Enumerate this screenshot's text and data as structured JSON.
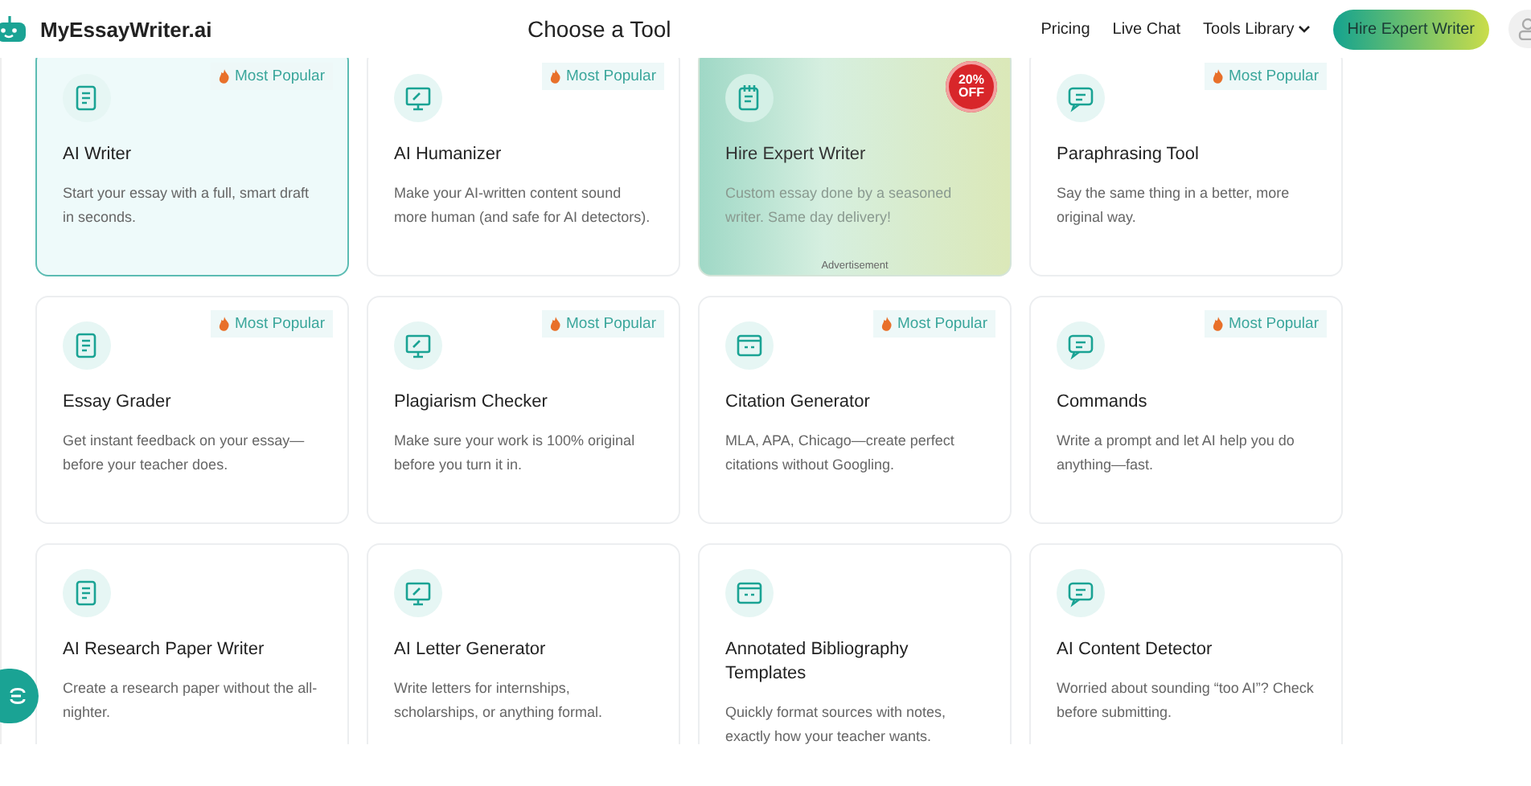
{
  "header": {
    "logo": "MyEssayWriter.ai",
    "title": "Choose a Tool",
    "nav": [
      {
        "label": "Pricing",
        "kind": "link"
      },
      {
        "label": "Live Chat",
        "kind": "link"
      },
      {
        "label": "Tools Library",
        "kind": "dropdown"
      }
    ],
    "cta": "Hire Expert Writer"
  },
  "cards": [
    {
      "kind": "tool",
      "title": "AI Writer",
      "description": "Start your essay with a full, smart draft in seconds.",
      "badge": "Most Popular",
      "selected": true
    },
    {
      "kind": "tool",
      "title": "AI Humanizer",
      "description": "Make your AI-written content sound more human (and safe for AI detectors).",
      "badge": "Most Popular",
      "selected": false
    },
    {
      "kind": "ad",
      "title": "Hire Expert Writer",
      "description": "Custom essay done by a seasoned writer. Same day delivery!",
      "badge": "20% OFF",
      "note": "Advertisement",
      "selected": false
    },
    {
      "kind": "tool",
      "title": "Paraphrasing Tool",
      "description": "Say the same thing in a better, more original way.",
      "badge": "Most Popular",
      "selected": false
    },
    {
      "kind": "tool",
      "title": "Essay Grader",
      "description": "Get instant feedback on your essay—before your teacher does.",
      "badge": "Most Popular",
      "selected": false
    },
    {
      "kind": "tool",
      "title": "Plagiarism Checker",
      "description": "Make sure your work is 100% original before you turn it in.",
      "badge": "Most Popular",
      "selected": false
    },
    {
      "kind": "tool",
      "title": "Citation Generator",
      "description": "MLA, APA, Chicago—create perfect citations without Googling.",
      "badge": "Most Popular",
      "selected": false
    },
    {
      "kind": "tool",
      "title": "Commands",
      "description": "Write a prompt and let AI help you do anything—fast.",
      "badge": "Most Popular",
      "selected": false
    },
    {
      "kind": "tool",
      "title": "AI Research Paper Writer",
      "description": "Create a research paper without the all-nighter.",
      "selected": false
    },
    {
      "kind": "tool",
      "title": "AI Letter Generator",
      "description": "Write letters for internships, scholarships, or anything formal.",
      "selected": false
    },
    {
      "kind": "tool",
      "title": "Annotated Bibliography Templates",
      "description": "Quickly format sources with notes, exactly how your teacher wants.",
      "selected": false
    },
    {
      "kind": "tool",
      "title": "AI Content Detector",
      "description": "Worried about sounding “too AI”? Check before submitting.",
      "selected": false
    }
  ]
}
